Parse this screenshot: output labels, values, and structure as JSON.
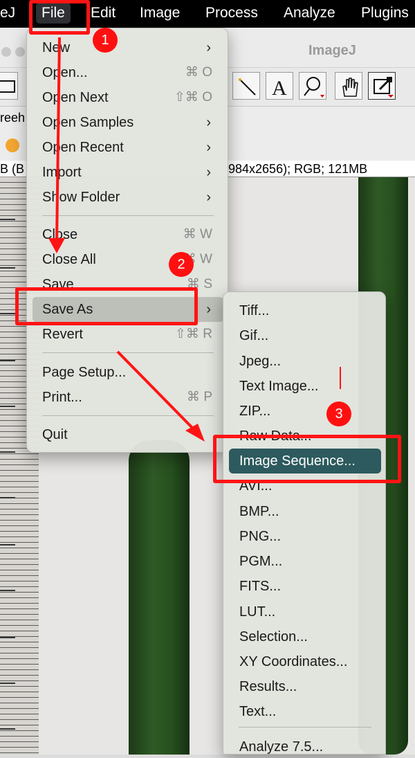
{
  "menubar": {
    "app_fragment": "eJ",
    "items": [
      "File",
      "Edit",
      "Image",
      "Process",
      "Analyze",
      "Plugins"
    ]
  },
  "window": {
    "title": "ImageJ",
    "toolbar_left_fragment": "reeh",
    "status_left": "B (B",
    "status_right": "984x2656); RGB; 121MB"
  },
  "file_menu": {
    "items": [
      {
        "label": "New",
        "shortcut": "",
        "submenu": true
      },
      {
        "label": "Open...",
        "shortcut": "⌘ O",
        "submenu": false
      },
      {
        "label": "Open Next",
        "shortcut": "⇧⌘ O",
        "submenu": false
      },
      {
        "label": "Open Samples",
        "shortcut": "",
        "submenu": true
      },
      {
        "label": "Open Recent",
        "shortcut": "",
        "submenu": true
      },
      {
        "label": "Import",
        "shortcut": "",
        "submenu": true
      },
      {
        "label": "Show Folder",
        "shortcut": "",
        "submenu": true
      },
      {
        "label": "Close",
        "shortcut": "⌘ W",
        "submenu": false
      },
      {
        "label": "Close All",
        "shortcut": "⇧⌘ W",
        "submenu": false
      },
      {
        "label": "Save",
        "shortcut": "⌘ S",
        "submenu": false
      },
      {
        "label": "Save As",
        "shortcut": "",
        "submenu": true,
        "highlighted": true
      },
      {
        "label": "Revert",
        "shortcut": "⇧⌘ R",
        "submenu": false
      },
      {
        "label": "Page Setup...",
        "shortcut": "",
        "submenu": false
      },
      {
        "label": "Print...",
        "shortcut": "⌘ P",
        "submenu": false
      },
      {
        "label": "Quit",
        "shortcut": "",
        "submenu": false
      }
    ]
  },
  "save_as_menu": {
    "items": [
      "Tiff...",
      "Gif...",
      "Jpeg...",
      "Text Image...",
      "ZIP...",
      "Raw Data...",
      "Image Sequence...",
      "AVI...",
      "BMP...",
      "PNG...",
      "PGM...",
      "FITS...",
      "LUT...",
      "Selection...",
      "XY Coordinates...",
      "Results...",
      "Text...",
      "Analyze 7.5..."
    ],
    "selected": "Image Sequence..."
  },
  "annotations": {
    "badges": [
      "1",
      "2",
      "3"
    ],
    "color": "#ff1414"
  },
  "colors": {
    "menu_highlight": "#bdbfb9",
    "selected_item": "#2d5a5e",
    "menubar_bg": "#000000"
  }
}
